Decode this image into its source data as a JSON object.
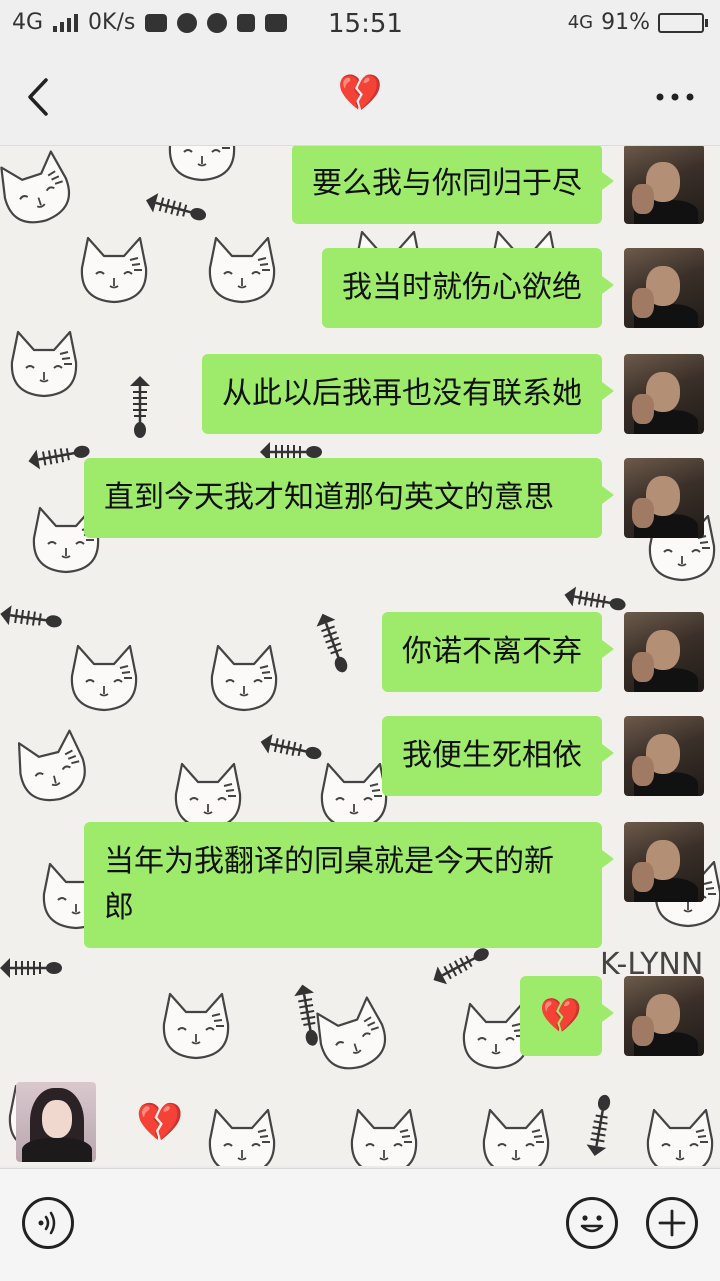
{
  "status_bar": {
    "network_left": "4G",
    "speed": "0K/s",
    "time": "15:51",
    "network_right": "4G",
    "battery_percent": "91%",
    "battery_level": 0.91
  },
  "header": {
    "title": "💔"
  },
  "messages": [
    {
      "text": "要么我与你同归于尽"
    },
    {
      "text": "我当时就伤心欲绝"
    },
    {
      "text": "从此以后我再也没有联系她"
    },
    {
      "text": "直到今天我才知道那句英文的意思"
    },
    {
      "text": "你诺不离不弃"
    },
    {
      "text": "我便生死相依"
    },
    {
      "text": "当年为我翻译的同桌就是今天的新郎"
    },
    {
      "text": "💔"
    }
  ],
  "incoming": {
    "text": "💔"
  },
  "wallpaper": {
    "signature": "K-LYNN"
  },
  "colors": {
    "bubble": "#9eea6a",
    "wallpaper_bg": "#f2f0ec"
  }
}
